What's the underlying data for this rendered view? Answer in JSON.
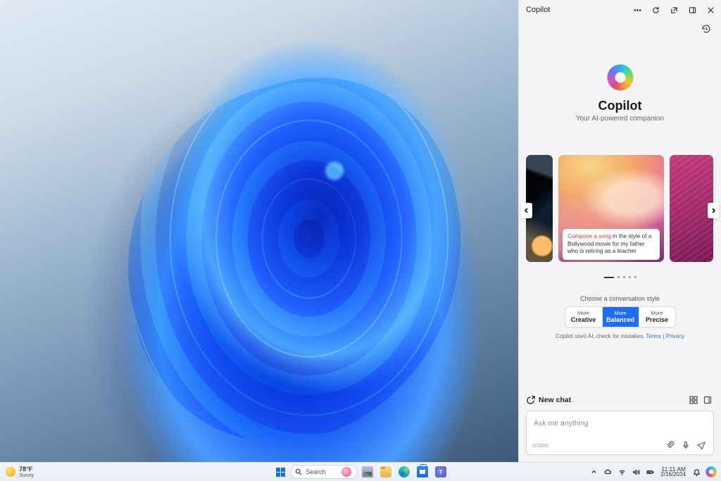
{
  "copilot": {
    "title": "Copilot",
    "heading": "Copilot",
    "subheading": "Your AI-powered companion",
    "carousel": {
      "prompt_accent": "Compose a song",
      "prompt_rest": " in the style of a Bollywood movie for my father who is retiring as a teacher"
    },
    "style_label": "Choose a conversation style",
    "styles": {
      "more": "More",
      "creative": "Creative",
      "balanced": "Balanced",
      "precise": "Precise"
    },
    "disclaimer_text": "Copilot uses AI, check for mistakes. ",
    "terms": "Terms",
    "sep": " | ",
    "privacy": "Privacy",
    "newchat": "New chat",
    "input_placeholder": "Ask me anything",
    "counter": "0/2000"
  },
  "taskbar": {
    "weather_temp": "78°F",
    "weather_cond": "Sunny",
    "search": "Search",
    "time": "11:11 AM",
    "date": "2/16/2024"
  }
}
